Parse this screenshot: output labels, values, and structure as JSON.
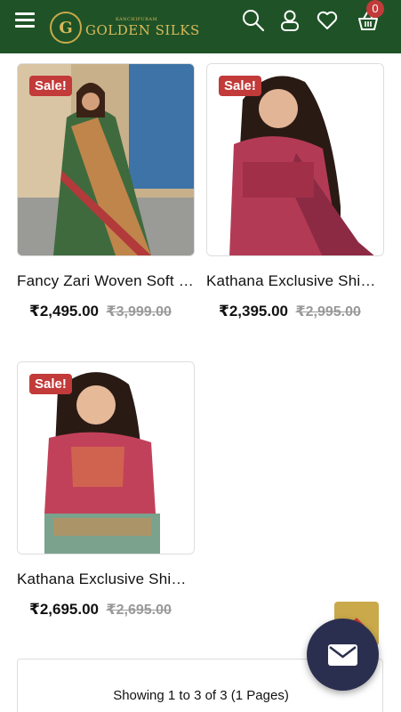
{
  "header": {
    "brand_small": "KANCHIPURAM",
    "brand_main": "GOLDEN SILKS",
    "brand_letter": "G",
    "cart_count": "0",
    "bg_color": "#1f5327",
    "accent_color": "#c9a94a",
    "icons": [
      "menu-icon",
      "search-icon",
      "user-icon",
      "heart-icon",
      "basket-icon"
    ]
  },
  "products": [
    {
      "badge": "Sale!",
      "title": "Fancy Zari Woven Soft Silk Saree",
      "price": "₹2,495.00",
      "old_price": "₹3,999.00"
    },
    {
      "badge": "Sale!",
      "title": "Kathana Exclusive Shimmer Saree",
      "price": "₹2,395.00",
      "old_price": "₹2,995.00"
    },
    {
      "badge": "Sale!",
      "title": "Kathana Exclusive Shimmer Saree",
      "price": "₹2,695.00",
      "old_price": "₹2,695.00"
    }
  ],
  "pagination": {
    "summary": "Showing 1 to 3 of 3 (1 Pages)"
  },
  "colors": {
    "sale_badge": "#c23a3a",
    "chat_fab": "#2b2f4f",
    "scroll_top": "#c9a94a"
  }
}
